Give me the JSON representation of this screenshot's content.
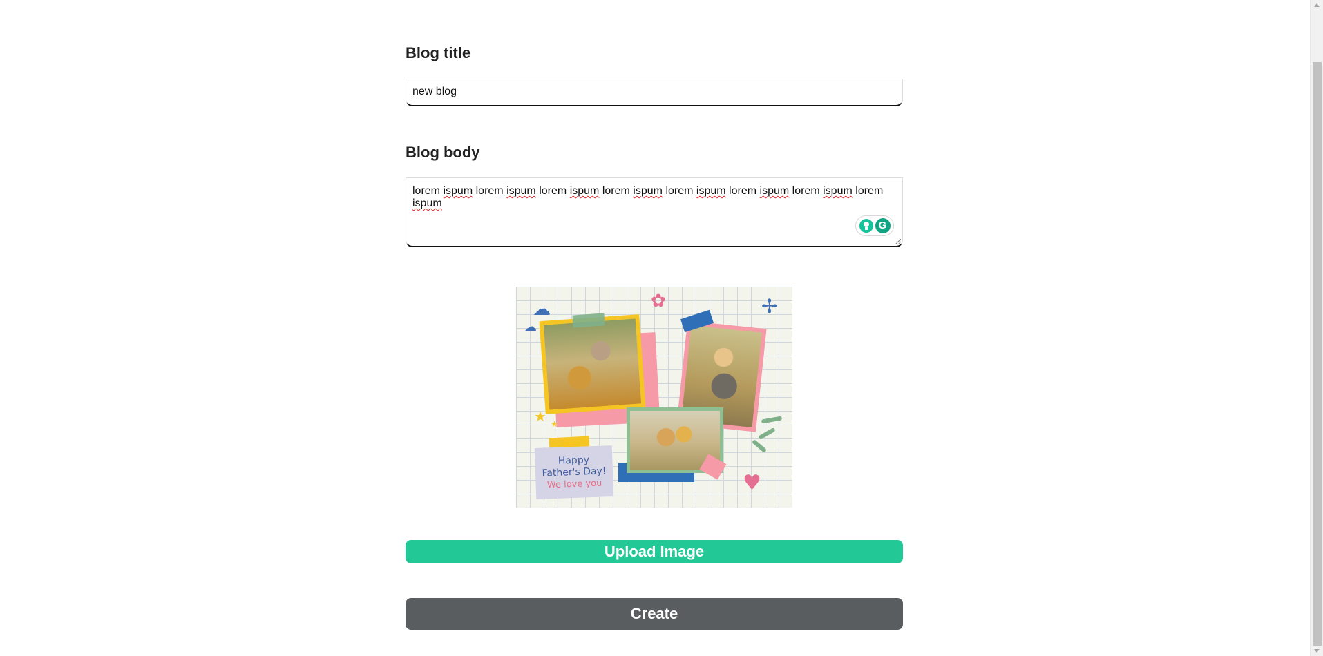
{
  "form": {
    "title_label": "Blog title",
    "title_value": "new blog",
    "body_label": "Blog body",
    "body_words": [
      "lorem",
      "ispum",
      "lorem",
      "ispum",
      "lorem",
      "ispum",
      "lorem",
      "ispum",
      "lorem",
      "ispum",
      "lorem",
      "ispum",
      "lorem",
      "ispum",
      "lorem",
      "ispum"
    ],
    "upload_label": "Upload Image",
    "create_label": "Create"
  },
  "preview": {
    "line1": "Happy",
    "line2": "Father's Day!",
    "line3": "We love you"
  },
  "colors": {
    "upload_button": "#22c997",
    "create_button": "#595d60",
    "spellcheck_underline": "#e02020"
  },
  "icons": [
    "grammarly-suggestion-icon",
    "grammarly-logo-icon"
  ]
}
